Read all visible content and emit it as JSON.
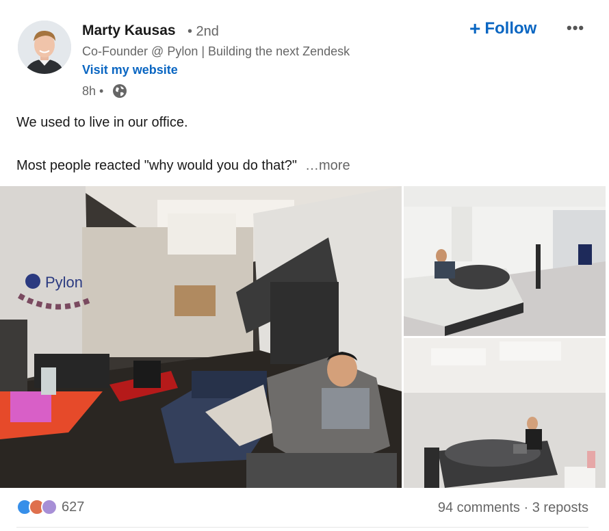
{
  "post": {
    "author": {
      "name": "Marty Kausas",
      "degree": "• 2nd",
      "headline": "Co-Founder @ Pylon | Building the next Zendesk",
      "website_label": "Visit my website",
      "time": "8h •",
      "visibility_icon": "globe-icon"
    },
    "follow_label": "Follow",
    "more_icon": "more-horizontal-icon",
    "text_line1": "We used to live in our office.",
    "text_line2": "Most people reacted \"why would you do that?\"",
    "see_more": "…more",
    "images": {
      "main_sign_text": "Pylon"
    },
    "social": {
      "reaction_icons": [
        "like-icon",
        "love-icon",
        "support-icon"
      ],
      "reaction_count": "627",
      "comments": "94 comments",
      "separator": "·",
      "reposts": "3 reposts"
    }
  },
  "colors": {
    "brand_blue": "#0a66c2",
    "muted_text": "#666666",
    "primary_text": "#191919"
  }
}
